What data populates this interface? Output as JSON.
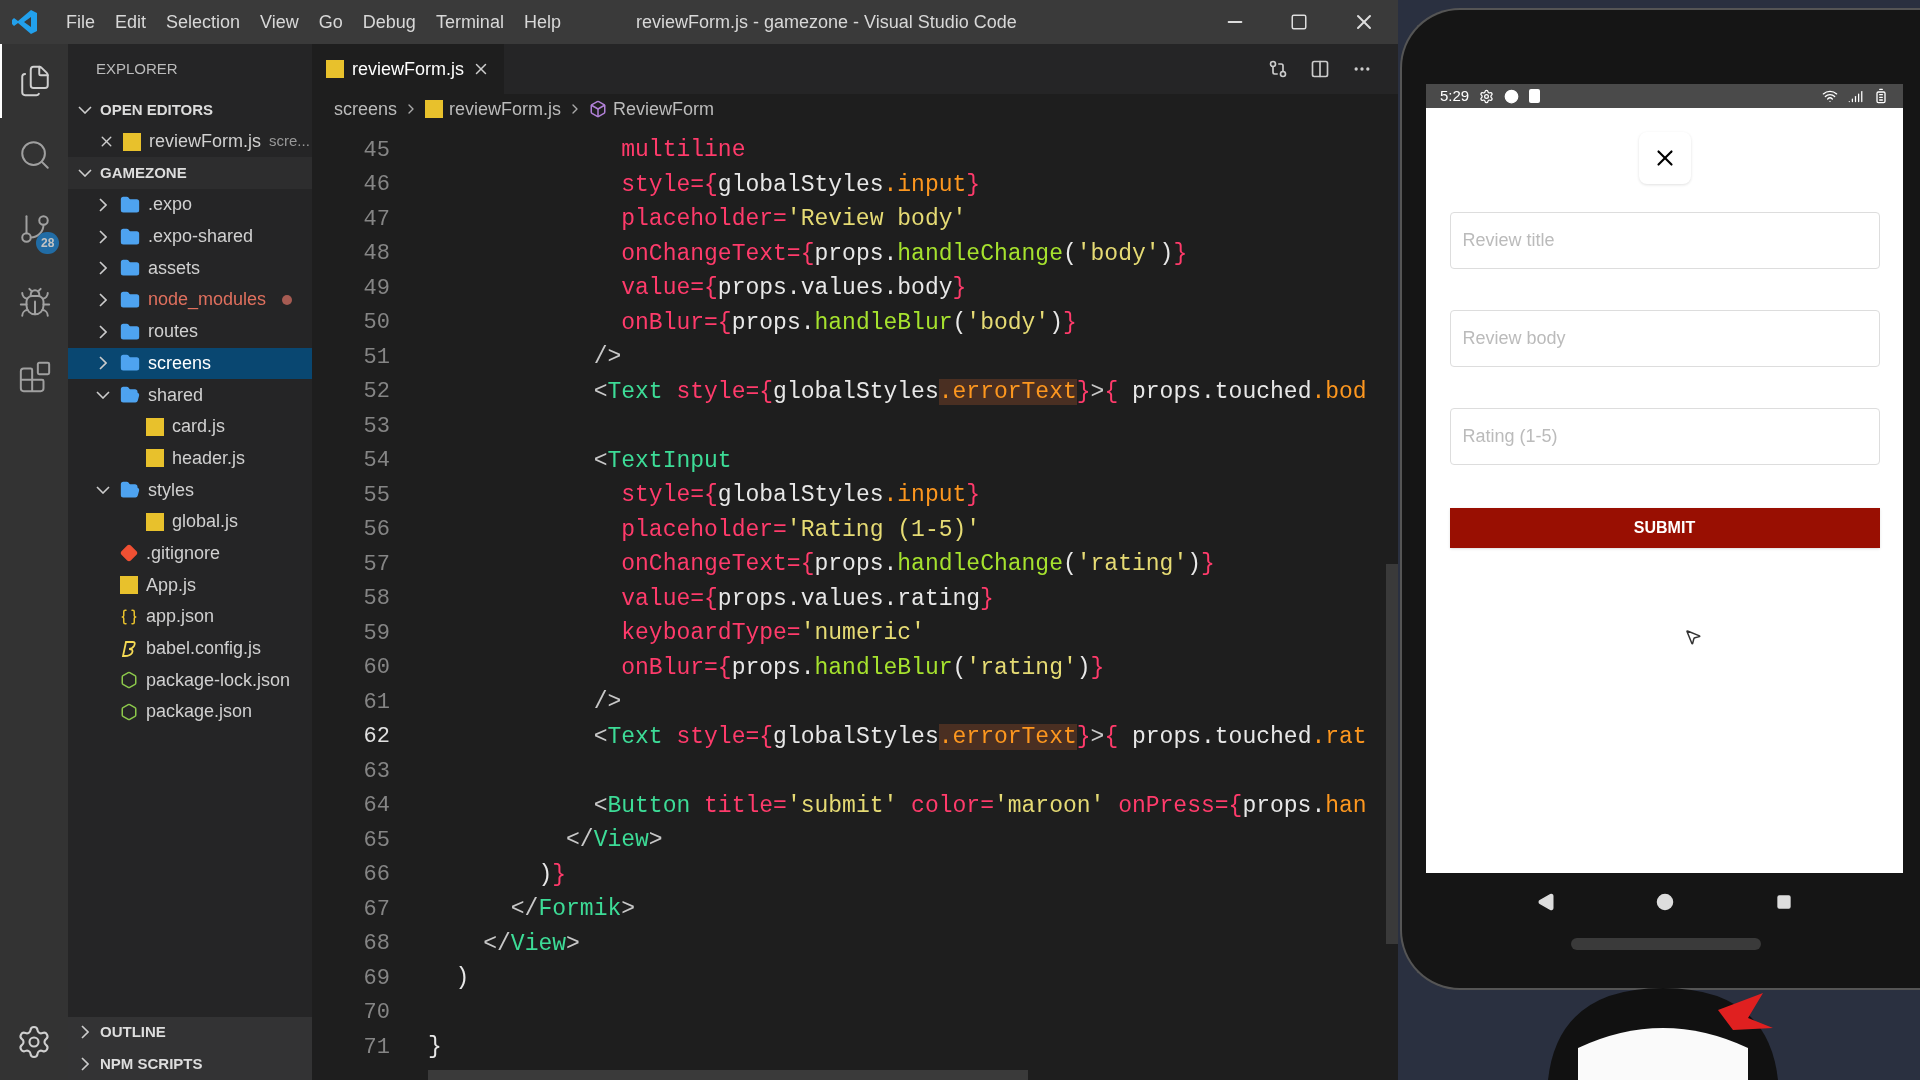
{
  "window": {
    "title": "reviewForm.js - gamezone - Visual Studio Code",
    "menu": [
      "File",
      "Edit",
      "Selection",
      "View",
      "Go",
      "Debug",
      "Terminal",
      "Help"
    ]
  },
  "activity_bar": {
    "items": [
      {
        "kind": "files",
        "selected": true
      },
      {
        "kind": "search",
        "selected": false
      },
      {
        "kind": "source_control",
        "selected": false,
        "badge": "28"
      },
      {
        "kind": "debug",
        "selected": false
      },
      {
        "kind": "extensions",
        "selected": false
      }
    ]
  },
  "sidebar": {
    "title": "EXPLORER",
    "open_editors": {
      "label": "OPEN EDITORS",
      "expanded": true,
      "files": [
        {
          "name": "reviewForm.js",
          "path": "scre...",
          "kind": "js"
        }
      ]
    },
    "project": {
      "label": "GAMEZONE",
      "expanded": true,
      "items": [
        {
          "name": ".expo",
          "kind": "folder",
          "expanded": false,
          "selected": false,
          "modified": false
        },
        {
          "name": ".expo-shared",
          "kind": "folder",
          "expanded": false,
          "selected": false,
          "modified": false
        },
        {
          "name": "assets",
          "kind": "folder",
          "expanded": false,
          "selected": false,
          "modified": false
        },
        {
          "name": "node_modules",
          "kind": "folder",
          "expanded": false,
          "selected": false,
          "modified": true
        },
        {
          "name": "routes",
          "kind": "folder",
          "expanded": false,
          "selected": false,
          "modified": false
        },
        {
          "name": "screens",
          "kind": "folder",
          "expanded": false,
          "selected": true,
          "modified": false
        },
        {
          "name": "shared",
          "kind": "folder",
          "expanded": true,
          "selected": false,
          "modified": false,
          "children": [
            {
              "name": "card.js",
              "kind": "js",
              "selected": false,
              "modified": false
            },
            {
              "name": "header.js",
              "kind": "js",
              "selected": false,
              "modified": false
            }
          ]
        },
        {
          "name": "styles",
          "kind": "folder",
          "expanded": true,
          "selected": false,
          "modified": false,
          "children": [
            {
              "name": "global.js",
              "kind": "js",
              "selected": false,
              "modified": false
            }
          ]
        },
        {
          "name": ".gitignore",
          "kind": "git",
          "selected": false,
          "modified": false
        },
        {
          "name": "App.js",
          "kind": "js",
          "selected": false,
          "modified": false
        },
        {
          "name": "app.json",
          "kind": "json",
          "selected": false,
          "modified": false
        },
        {
          "name": "babel.config.js",
          "kind": "babel",
          "selected": false,
          "modified": false
        },
        {
          "name": "package-lock.json",
          "kind": "node",
          "selected": false,
          "modified": false
        },
        {
          "name": "package.json",
          "kind": "node",
          "selected": false,
          "modified": false
        }
      ]
    },
    "sections": [
      {
        "label": "OUTLINE",
        "expanded": false
      },
      {
        "label": "NPM SCRIPTS",
        "expanded": false
      }
    ]
  },
  "editor": {
    "tabs": [
      {
        "label": "reviewForm.js",
        "kind": "js",
        "selected": true
      }
    ],
    "breadcrumbs": [
      {
        "label": "screens",
        "kind": "folder"
      },
      {
        "label": "reviewForm.js",
        "kind": "js"
      },
      {
        "label": "ReviewForm",
        "kind": "symbol"
      }
    ],
    "lines": [
      {
        "number": "45",
        "current": false,
        "tokens": [
          {
            "kind": "attr",
            "text": "              multiline"
          }
        ]
      },
      {
        "number": "46",
        "current": false,
        "tokens": [
          {
            "kind": "attr",
            "text": "              style="
          },
          {
            "kind": "brace",
            "text": "{"
          },
          {
            "kind": "id",
            "text": "globalStyles"
          },
          {
            "kind": "prop",
            "text": ".input"
          },
          {
            "kind": "brace",
            "text": "}"
          }
        ]
      },
      {
        "number": "47",
        "current": false,
        "tokens": [
          {
            "kind": "attr",
            "text": "              placeholder="
          },
          {
            "kind": "str",
            "text": "'Review body'"
          }
        ]
      },
      {
        "number": "48",
        "current": false,
        "tokens": [
          {
            "kind": "attr",
            "text": "              onChangeText="
          },
          {
            "kind": "brace",
            "text": "{"
          },
          {
            "kind": "id",
            "text": "props."
          },
          {
            "kind": "fn",
            "text": "handleChange"
          },
          {
            "kind": "id",
            "text": "("
          },
          {
            "kind": "str",
            "text": "'body'"
          },
          {
            "kind": "id",
            "text": ")"
          },
          {
            "kind": "brace",
            "text": "}"
          }
        ]
      },
      {
        "number": "49",
        "current": false,
        "tokens": [
          {
            "kind": "attr",
            "text": "              value="
          },
          {
            "kind": "brace",
            "text": "{"
          },
          {
            "kind": "id",
            "text": "props.values.body"
          },
          {
            "kind": "brace",
            "text": "}"
          }
        ]
      },
      {
        "number": "50",
        "current": false,
        "tokens": [
          {
            "kind": "attr",
            "text": "              onBlur="
          },
          {
            "kind": "brace",
            "text": "{"
          },
          {
            "kind": "id",
            "text": "props."
          },
          {
            "kind": "fn",
            "text": "handleBlur"
          },
          {
            "kind": "id",
            "text": "("
          },
          {
            "kind": "str",
            "text": "'body'"
          },
          {
            "kind": "id",
            "text": ")"
          },
          {
            "kind": "brace",
            "text": "}"
          }
        ]
      },
      {
        "number": "51",
        "current": false,
        "tokens": [
          {
            "kind": "punct",
            "text": "            />"
          }
        ]
      },
      {
        "number": "52",
        "current": false,
        "tokens": [
          {
            "kind": "punct",
            "text": "            <"
          },
          {
            "kind": "tag",
            "text": "Text"
          },
          {
            "kind": "attr",
            "text": " style="
          },
          {
            "kind": "brace",
            "text": "{"
          },
          {
            "kind": "id",
            "text": "globalStyles"
          },
          {
            "kind": "hl",
            "text": ".errorText"
          },
          {
            "kind": "brace",
            "text": "}"
          },
          {
            "kind": "punct",
            "text": ">"
          },
          {
            "kind": "brace",
            "text": "{"
          },
          {
            "kind": "id",
            "text": " props.touched"
          },
          {
            "kind": "prop",
            "text": ".bod"
          }
        ]
      },
      {
        "number": "53",
        "current": false
      },
      {
        "number": "54",
        "current": false,
        "tokens": [
          {
            "kind": "punct",
            "text": "            <"
          },
          {
            "kind": "tag",
            "text": "TextInput"
          }
        ]
      },
      {
        "number": "55",
        "current": false,
        "tokens": [
          {
            "kind": "attr",
            "text": "              style="
          },
          {
            "kind": "brace",
            "text": "{"
          },
          {
            "kind": "id",
            "text": "globalStyles"
          },
          {
            "kind": "prop",
            "text": ".input"
          },
          {
            "kind": "brace",
            "text": "}"
          }
        ]
      },
      {
        "number": "56",
        "current": false,
        "tokens": [
          {
            "kind": "attr",
            "text": "              placeholder="
          },
          {
            "kind": "str",
            "text": "'Rating (1-5)'"
          }
        ]
      },
      {
        "number": "57",
        "current": false,
        "tokens": [
          {
            "kind": "attr",
            "text": "              onChangeText="
          },
          {
            "kind": "brace",
            "text": "{"
          },
          {
            "kind": "id",
            "text": "props."
          },
          {
            "kind": "fn",
            "text": "handleChange"
          },
          {
            "kind": "id",
            "text": "("
          },
          {
            "kind": "str",
            "text": "'rating'"
          },
          {
            "kind": "id",
            "text": ")"
          },
          {
            "kind": "brace",
            "text": "}"
          }
        ]
      },
      {
        "number": "58",
        "current": false,
        "tokens": [
          {
            "kind": "attr",
            "text": "              value="
          },
          {
            "kind": "brace",
            "text": "{"
          },
          {
            "kind": "id",
            "text": "props.values.rating"
          },
          {
            "kind": "brace",
            "text": "}"
          }
        ]
      },
      {
        "number": "59",
        "current": false,
        "tokens": [
          {
            "kind": "attr",
            "text": "              keyboardType="
          },
          {
            "kind": "str",
            "text": "'numeric'"
          }
        ]
      },
      {
        "number": "60",
        "current": false,
        "tokens": [
          {
            "kind": "attr",
            "text": "              onBlur="
          },
          {
            "kind": "brace",
            "text": "{"
          },
          {
            "kind": "id",
            "text": "props."
          },
          {
            "kind": "fn",
            "text": "handleBlur"
          },
          {
            "kind": "id",
            "text": "("
          },
          {
            "kind": "str",
            "text": "'rating'"
          },
          {
            "kind": "id",
            "text": ")"
          },
          {
            "kind": "brace",
            "text": "}"
          }
        ]
      },
      {
        "number": "61",
        "current": false,
        "tokens": [
          {
            "kind": "punct",
            "text": "            />"
          }
        ]
      },
      {
        "number": "62",
        "current": true,
        "tokens": [
          {
            "kind": "punct",
            "text": "            <"
          },
          {
            "kind": "tag",
            "text": "Text"
          },
          {
            "kind": "attr",
            "text": " style="
          },
          {
            "kind": "brace",
            "text": "{"
          },
          {
            "kind": "id",
            "text": "globalStyles"
          },
          {
            "kind": "hl",
            "text": ".errorText"
          },
          {
            "kind": "brace",
            "text": "}"
          },
          {
            "kind": "punct",
            "text": ">"
          },
          {
            "kind": "brace",
            "text": "{"
          },
          {
            "kind": "id",
            "text": " props.touched"
          },
          {
            "kind": "prop",
            "text": ".rat"
          }
        ]
      },
      {
        "number": "63",
        "current": false
      },
      {
        "number": "64",
        "current": false,
        "tokens": [
          {
            "kind": "punct",
            "text": "            <"
          },
          {
            "kind": "tag",
            "text": "Button"
          },
          {
            "kind": "attr",
            "text": " title="
          },
          {
            "kind": "str",
            "text": "'submit'"
          },
          {
            "kind": "attr",
            "text": " color="
          },
          {
            "kind": "str",
            "text": "'maroon'"
          },
          {
            "kind": "attr",
            "text": " onPress="
          },
          {
            "kind": "brace",
            "text": "{"
          },
          {
            "kind": "id",
            "text": "props."
          },
          {
            "kind": "prop",
            "text": "han"
          }
        ]
      },
      {
        "number": "65",
        "current": false,
        "tokens": [
          {
            "kind": "punct",
            "text": "          </"
          },
          {
            "kind": "tag",
            "text": "View"
          },
          {
            "kind": "punct",
            "text": ">"
          }
        ]
      },
      {
        "number": "66",
        "current": false,
        "tokens": [
          {
            "kind": "id",
            "text": "        )"
          },
          {
            "kind": "brace",
            "text": "}"
          }
        ]
      },
      {
        "number": "67",
        "current": false,
        "tokens": [
          {
            "kind": "punct",
            "text": "      </"
          },
          {
            "kind": "tag",
            "text": "Formik"
          },
          {
            "kind": "punct",
            "text": ">"
          }
        ]
      },
      {
        "number": "68",
        "current": false,
        "tokens": [
          {
            "kind": "punct",
            "text": "    </"
          },
          {
            "kind": "tag",
            "text": "View"
          },
          {
            "kind": "punct",
            "text": ">"
          }
        ]
      },
      {
        "number": "69",
        "current": false,
        "tokens": [
          {
            "kind": "id",
            "text": "  )"
          }
        ]
      },
      {
        "number": "70",
        "current": false
      },
      {
        "number": "71",
        "current": false,
        "tokens": [
          {
            "kind": "id",
            "text": "}"
          }
        ]
      }
    ]
  },
  "phone": {
    "time": "5:29",
    "fields": [
      {
        "placeholder": "Review title"
      },
      {
        "placeholder": "Review body"
      },
      {
        "placeholder": "Rating (1-5)"
      }
    ],
    "submit": "SUBMIT"
  }
}
